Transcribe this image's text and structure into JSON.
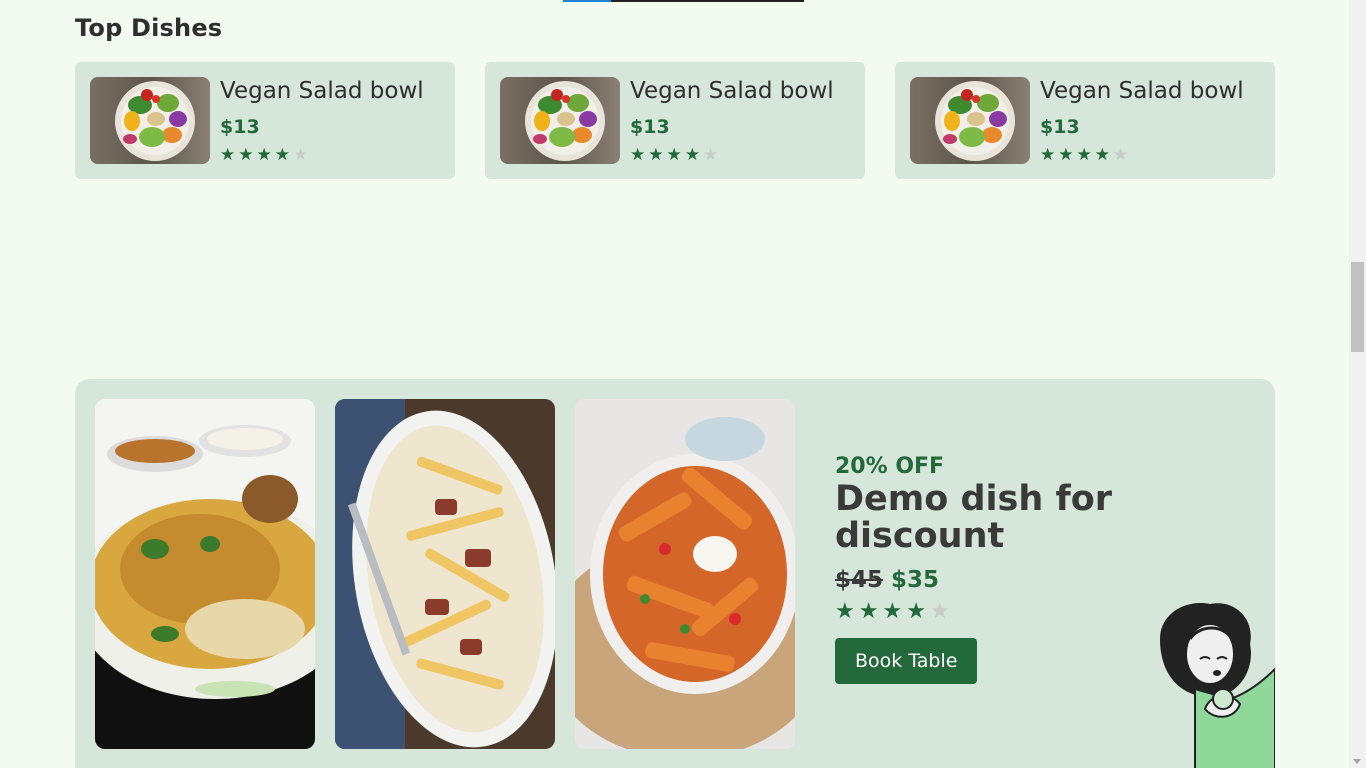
{
  "header": {
    "section_title": "Top Dishes"
  },
  "dishes": [
    {
      "name": "Vegan Salad bowl",
      "price": "$13",
      "rating": 4,
      "max_rating": 5
    },
    {
      "name": "Vegan Salad bowl",
      "price": "$13",
      "rating": 4,
      "max_rating": 5
    },
    {
      "name": "Vegan Salad bowl",
      "price": "$13",
      "rating": 4,
      "max_rating": 5
    }
  ],
  "promo": {
    "images": [
      "biryani-image",
      "steak-fries-image",
      "sweet-potato-fries-image"
    ],
    "discount_label": "20% OFF",
    "title": "Demo dish for discount",
    "old_price": "$45",
    "new_price": "$35",
    "rating": 4,
    "max_rating": 5,
    "book_button_label": "Book Table"
  },
  "colors": {
    "brand": "#23693b",
    "page_background": "#f3fbf1",
    "card_background": "#d7e6da",
    "star_off": "#c8cdc9"
  },
  "scroll_position": 0.35
}
